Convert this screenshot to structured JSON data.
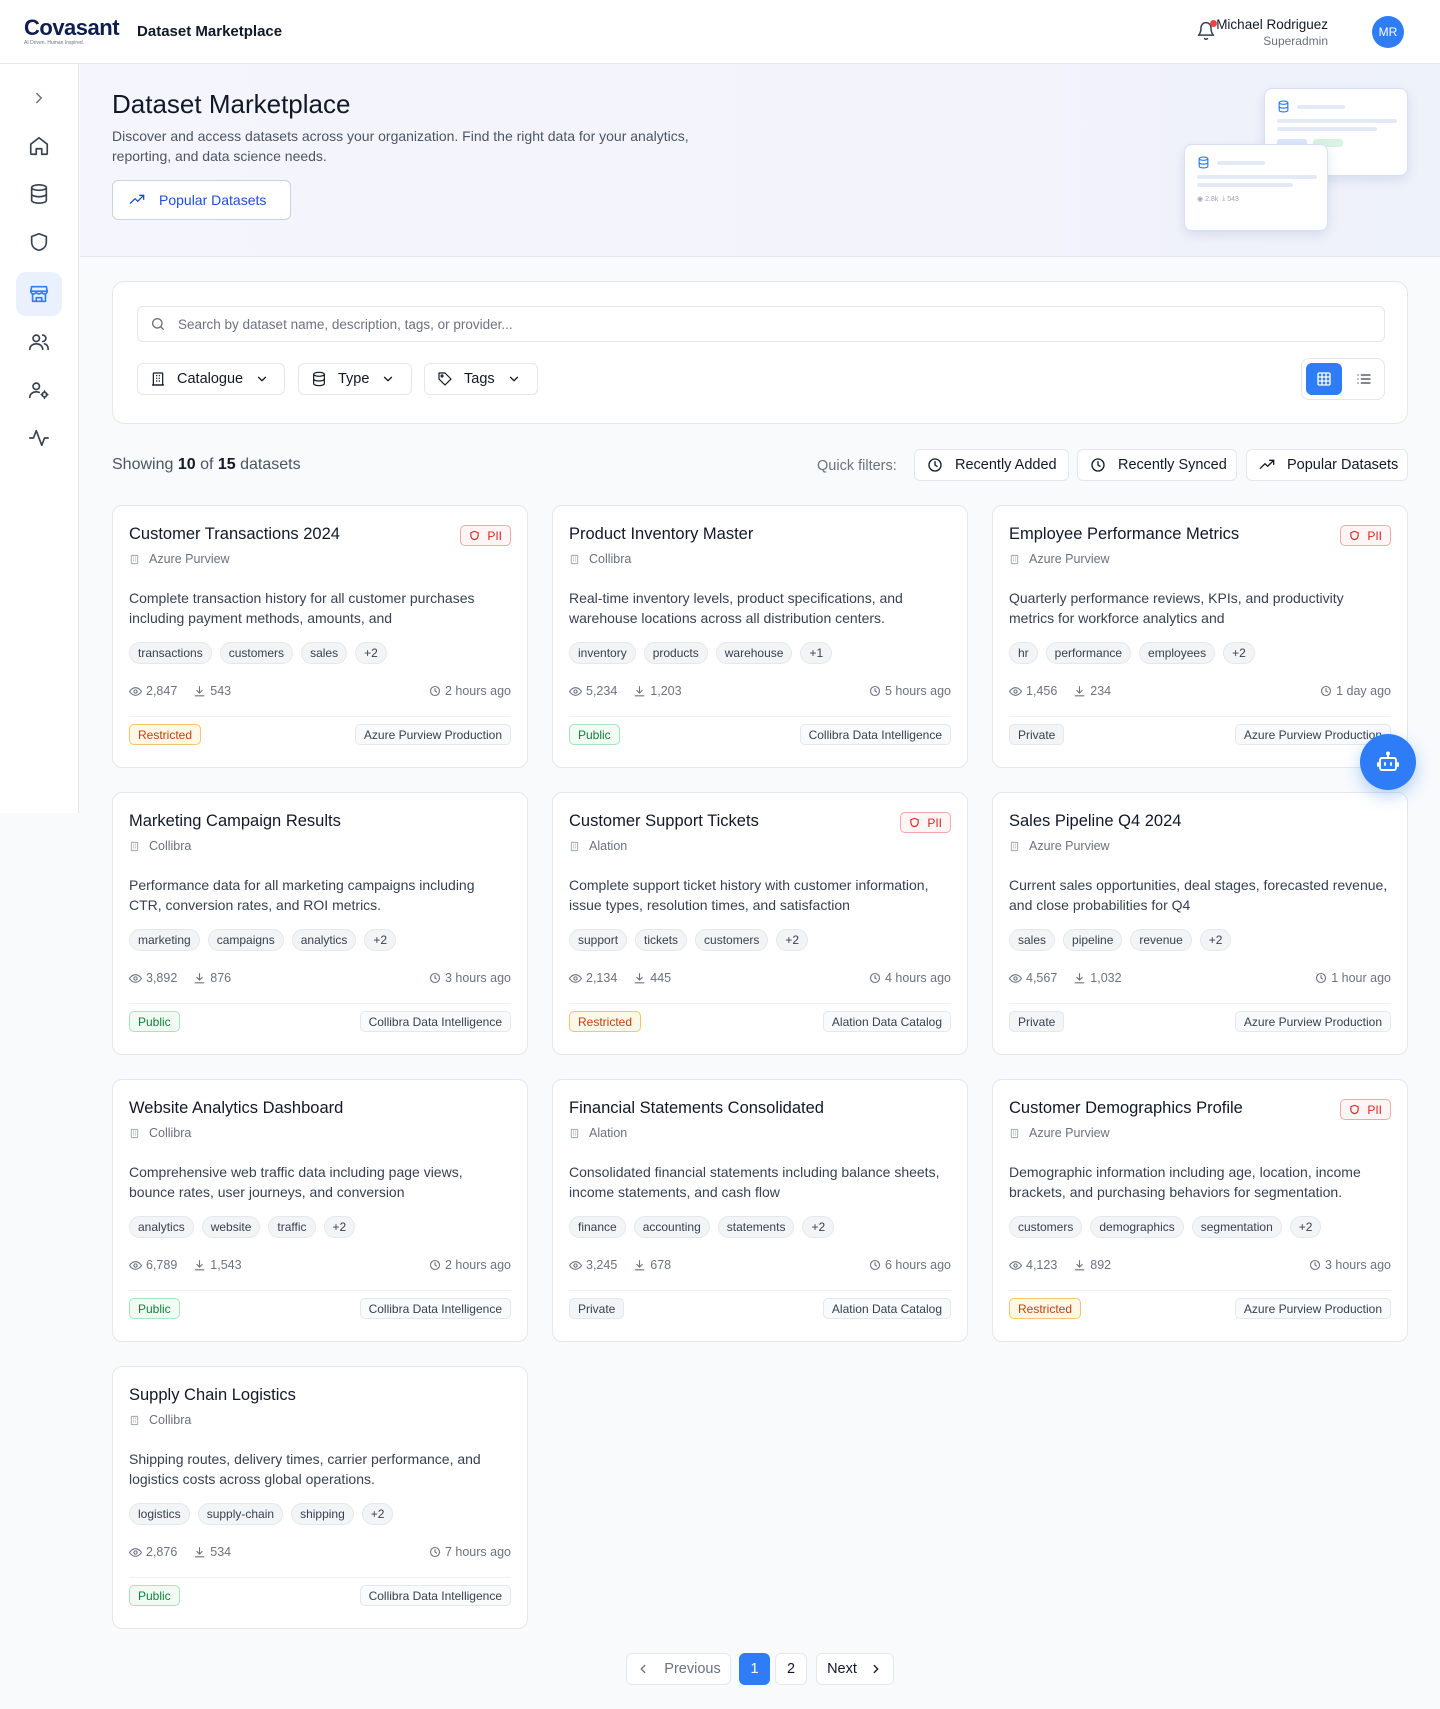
{
  "header": {
    "logo_word": "Covasant",
    "logo_tagline": "AI Driven. Human Inspired.",
    "app_title": "Dataset Marketplace",
    "user_name": "Michael Rodriguez",
    "user_role": "Superadmin",
    "avatar_initials": "MR",
    "notification_dot_color": "#ef4444"
  },
  "sidebar": {
    "items": [
      {
        "icon": "chevron-right-icon"
      },
      {
        "icon": "home-icon"
      },
      {
        "icon": "database-icon"
      },
      {
        "icon": "shield-icon"
      },
      {
        "icon": "store-icon",
        "active": true
      },
      {
        "icon": "users-icon"
      },
      {
        "icon": "user-settings-icon"
      },
      {
        "icon": "activity-icon"
      }
    ]
  },
  "hero": {
    "title": "Dataset Marketplace",
    "subtitle": "Discover and access datasets across your organization. Find the right data for your analytics, reporting, and data science needs.",
    "popular_button": "Popular Datasets",
    "mini_views": "2.8k",
    "mini_downloads": "543"
  },
  "filters": {
    "search_placeholder": "Search by dataset name, description, tags, or provider...",
    "catalogue": "Catalogue",
    "type": "Type",
    "tags": "Tags",
    "view_mode": "grid"
  },
  "summary": {
    "prefix": "Showing",
    "shown": "10",
    "of": "of",
    "total": "15",
    "suffix": "datasets",
    "quick_filters_label": "Quick filters:",
    "quick_filters": [
      "Recently Added",
      "Recently Synced",
      "Popular Datasets"
    ]
  },
  "datasets": [
    {
      "title": "Customer Transactions 2024",
      "pii": true,
      "provider": "Azure Purview",
      "description": "Complete transaction history for all customer purchases including payment methods, amounts, and",
      "tags": [
        "transactions",
        "customers",
        "sales",
        "+2"
      ],
      "views": "2,847",
      "downloads": "543",
      "updated": "2 hours ago",
      "access": "Restricted",
      "source": "Azure Purview Production"
    },
    {
      "title": "Product Inventory Master",
      "pii": false,
      "provider": "Collibra",
      "description": "Real-time inventory levels, product specifications, and warehouse locations across all distribution centers.",
      "tags": [
        "inventory",
        "products",
        "warehouse",
        "+1"
      ],
      "views": "5,234",
      "downloads": "1,203",
      "updated": "5 hours ago",
      "access": "Public",
      "source": "Collibra Data Intelligence"
    },
    {
      "title": "Employee Performance Metrics",
      "pii": true,
      "provider": "Azure Purview",
      "description": "Quarterly performance reviews, KPIs, and productivity metrics for workforce analytics and",
      "tags": [
        "hr",
        "performance",
        "employees",
        "+2"
      ],
      "views": "1,456",
      "downloads": "234",
      "updated": "1 day ago",
      "access": "Private",
      "source": "Azure Purview Production"
    },
    {
      "title": "Marketing Campaign Results",
      "pii": false,
      "provider": "Collibra",
      "description": "Performance data for all marketing campaigns including CTR, conversion rates, and ROI metrics.",
      "tags": [
        "marketing",
        "campaigns",
        "analytics",
        "+2"
      ],
      "views": "3,892",
      "downloads": "876",
      "updated": "3 hours ago",
      "access": "Public",
      "source": "Collibra Data Intelligence"
    },
    {
      "title": "Customer Support Tickets",
      "pii": true,
      "provider": "Alation",
      "description": "Complete support ticket history with customer information, issue types, resolution times, and satisfaction",
      "tags": [
        "support",
        "tickets",
        "customers",
        "+2"
      ],
      "views": "2,134",
      "downloads": "445",
      "updated": "4 hours ago",
      "access": "Restricted",
      "source": "Alation Data Catalog"
    },
    {
      "title": "Sales Pipeline Q4 2024",
      "pii": false,
      "provider": "Azure Purview",
      "description": "Current sales opportunities, deal stages, forecasted revenue, and close probabilities for Q4",
      "tags": [
        "sales",
        "pipeline",
        "revenue",
        "+2"
      ],
      "views": "4,567",
      "downloads": "1,032",
      "updated": "1 hour ago",
      "access": "Private",
      "source": "Azure Purview Production"
    },
    {
      "title": "Website Analytics Dashboard",
      "pii": false,
      "provider": "Collibra",
      "description": "Comprehensive web traffic data including page views, bounce rates, user journeys, and conversion",
      "tags": [
        "analytics",
        "website",
        "traffic",
        "+2"
      ],
      "views": "6,789",
      "downloads": "1,543",
      "updated": "2 hours ago",
      "access": "Public",
      "source": "Collibra Data Intelligence"
    },
    {
      "title": "Financial Statements Consolidated",
      "pii": false,
      "provider": "Alation",
      "description": "Consolidated financial statements including balance sheets, income statements, and cash flow",
      "tags": [
        "finance",
        "accounting",
        "statements",
        "+2"
      ],
      "views": "3,245",
      "downloads": "678",
      "updated": "6 hours ago",
      "access": "Private",
      "source": "Alation Data Catalog"
    },
    {
      "title": "Customer Demographics Profile",
      "pii": true,
      "provider": "Azure Purview",
      "description": "Demographic information including age, location, income brackets, and purchasing behaviors for segmentation.",
      "tags": [
        "customers",
        "demographics",
        "segmentation",
        "+2"
      ],
      "views": "4,123",
      "downloads": "892",
      "updated": "3 hours ago",
      "access": "Restricted",
      "source": "Azure Purview Production"
    },
    {
      "title": "Supply Chain Logistics",
      "pii": false,
      "provider": "Collibra",
      "description": "Shipping routes, delivery times, carrier performance, and logistics costs across global operations.",
      "tags": [
        "logistics",
        "supply-chain",
        "shipping",
        "+2"
      ],
      "views": "2,876",
      "downloads": "534",
      "updated": "7 hours ago",
      "access": "Public",
      "source": "Collibra Data Intelligence"
    }
  ],
  "pii_label": "PII",
  "pagination": {
    "previous": "Previous",
    "pages": [
      "1",
      "2"
    ],
    "current": "1",
    "next": "Next"
  },
  "colors": {
    "accent": "#2f7df6",
    "pii": "#dc2626",
    "restricted": "#c2410c",
    "public": "#15803d"
  }
}
